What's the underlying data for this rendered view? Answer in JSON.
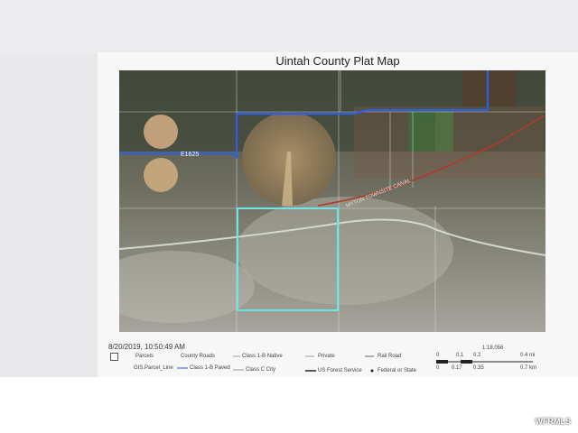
{
  "map_title": "Uintah County Plat Map",
  "timestamp": "8/20/2019, 10:50:49 AM",
  "labels": {
    "road_left": "E1625",
    "canal": "MYTON TOWNSITE CANAL"
  },
  "legend": {
    "parcels": "Parcels",
    "county_roads": "County Roads",
    "class_1b_native": "Class 1-B Native",
    "private": "Private",
    "rail_road": "Rail Road",
    "gis_parcel_line": "GIS.Parcel_Line",
    "class_1b_paved": "Class 1-B Paved",
    "class_c_city": "Class C City",
    "us_forest_service": "US Forest Service",
    "federal_or_state": "Federal or State"
  },
  "scale": {
    "ratio": "1:18,056",
    "mi_ticks": [
      "0",
      "0.1",
      "0.2",
      "0.4 mi"
    ],
    "km_ticks": [
      "0",
      "0.17",
      "0.35",
      "0.7 km"
    ]
  },
  "watermark": "WFRMLS",
  "colors": {
    "county_road": "#2f5fe0",
    "parcel_outline": "#6fe6e6",
    "canal": "#b03a2e"
  }
}
